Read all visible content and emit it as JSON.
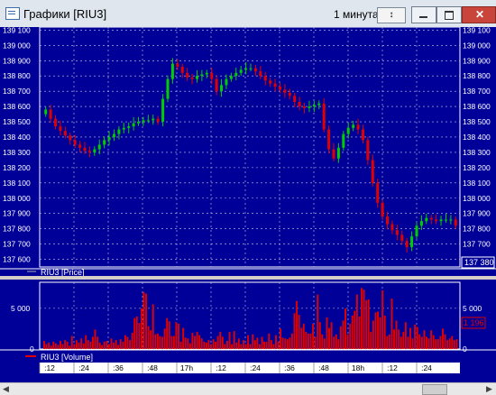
{
  "window": {
    "title": "Графики [RIU3]",
    "timeframe": "1 минута",
    "timeframe_button": "↕"
  },
  "price_panel": {
    "legend": "RIU3 [Price]",
    "last_value": "137 380",
    "y_ticks": [
      "139 100",
      "139 000",
      "138 900",
      "138 800",
      "138 700",
      "138 600",
      "138 500",
      "138 400",
      "138 300",
      "138 200",
      "138 100",
      "138 000",
      "137 900",
      "137 800",
      "137 700",
      "137 600"
    ]
  },
  "volume_panel": {
    "legend": "RIU3 [Volume]",
    "last_value": "1 196",
    "y_ticks": [
      "5 000",
      "0"
    ]
  },
  "time_axis": {
    "ticks": [
      ":12",
      ":24",
      ":36",
      ":48",
      "17h",
      ":12",
      ":24",
      ":36",
      ":48",
      "18h",
      ":12",
      ":24"
    ]
  },
  "colors": {
    "background": "#000099",
    "up": "#00cc00",
    "down": "#e00000",
    "grid": "#c8c8e6"
  },
  "chart_data": [
    {
      "type": "candlestick",
      "title": "RIU3 [Price]",
      "ylim": [
        137550,
        139120
      ],
      "series": [
        {
          "name": "RIU3 [Price]",
          "values": [
            138580,
            138520,
            138470,
            138440,
            138410,
            138380,
            138350,
            138330,
            138310,
            138300,
            138320,
            138350,
            138380,
            138400,
            138420,
            138450,
            138460,
            138470,
            138490,
            138500,
            138510,
            138510,
            138520,
            138500,
            138650,
            138780,
            138880,
            138860,
            138820,
            138790,
            138780,
            138800,
            138810,
            138820,
            138780,
            138700,
            138740,
            138780,
            138800,
            138820,
            138840,
            138850,
            138850,
            138830,
            138800,
            138770,
            138750,
            138730,
            138710,
            138690,
            138670,
            138630,
            138600,
            138590,
            138600,
            138610,
            138620,
            138450,
            138320,
            138260,
            138330,
            138420,
            138460,
            138480,
            138450,
            138380,
            138250,
            138100,
            137970,
            137880,
            137830,
            137790,
            137760,
            137720,
            137680,
            137750,
            137820,
            137850,
            137870,
            137860,
            137850,
            137860,
            137860,
            137860,
            137820
          ]
        }
      ]
    },
    {
      "type": "bar",
      "title": "RIU3 [Volume]",
      "ylim": [
        0,
        8200
      ],
      "series": [
        {
          "name": "RIU3 [Volume]",
          "values": [
            1000,
            600,
            800,
            400,
            900,
            700,
            500,
            1000,
            600,
            1100,
            900,
            400,
            1600,
            600,
            1100,
            800,
            1300,
            700,
            1700,
            1100,
            900,
            1500,
            2400,
            1500,
            800,
            500,
            900,
            1000,
            600,
            1300,
            800,
            1100,
            500,
            1200,
            900,
            1700,
            1500,
            1100,
            2000,
            3800,
            4000,
            3200,
            5000,
            7000,
            6800,
            2800,
            2300,
            5500,
            1800,
            1900,
            1600,
            1500,
            2500,
            3800,
            3400,
            1600,
            1600,
            3300,
            3100,
            900,
            2600,
            1400,
            1300,
            700,
            2000,
            1600,
            2100,
            1700,
            1300,
            900,
            800,
            1100,
            600,
            1200,
            900,
            1600,
            2100,
            1500,
            600,
            1000,
            2100,
            600,
            2200,
            800,
            1300,
            600,
            1100,
            600,
            1700,
            600,
            1800,
            1100,
            1400,
            600,
            1500,
            900,
            900,
            1900,
            1100,
            600,
            1700,
            900,
            2500,
            1400,
            1300,
            1200,
            1400,
            1900,
            4400,
            5900,
            4200,
            2600,
            3100,
            2100,
            1900,
            1900,
            3100,
            1500,
            6700,
            3300,
            1800,
            1300,
            3900,
            2600,
            3300,
            1500,
            1800,
            1200,
            2800,
            3500,
            5000,
            1800,
            3100,
            4100,
            4700,
            6700,
            4000,
            7500,
            7300,
            6000,
            6100,
            2100,
            3500,
            4500,
            4600,
            3900,
            7200,
            4100,
            1600,
            1800,
            6200,
            2400,
            3500,
            2400,
            1500,
            2100,
            3300,
            1500,
            2600,
            1300,
            3000,
            2700,
            1800,
            1500,
            2300,
            1500,
            1300,
            2300,
            1700,
            1200,
            1200,
            1600,
            2500,
            1800,
            1100,
            1300,
            1600,
            1100,
            1200
          ]
        }
      ]
    }
  ]
}
